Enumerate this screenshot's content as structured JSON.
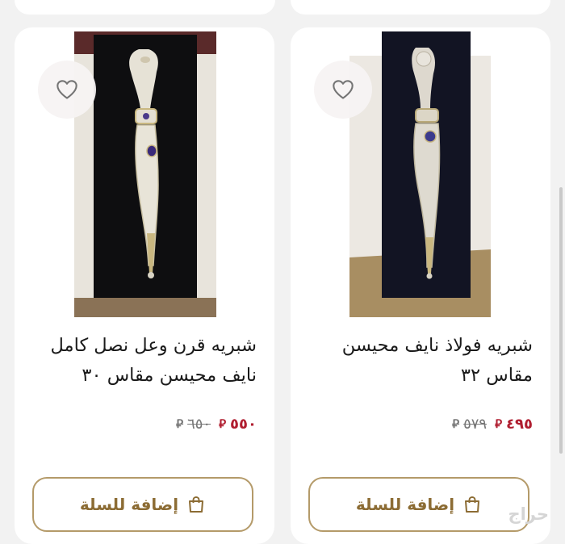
{
  "products": [
    {
      "title": "شبريه قرن وعل نصل كامل نايف محيسن مقاس ٣٠",
      "price_new": "٥٥٠",
      "price_old": "٦٥٠",
      "currency_symbol": "⃁",
      "add_to_cart_label": "إضافة للسلة",
      "favorite_icon": "heart-icon",
      "cart_icon": "shopping-bag-icon"
    },
    {
      "title": "شبريه فولاذ نايف محيسن مقاس ٣٢",
      "price_new": "٤٩٥",
      "price_old": "٥٧٩",
      "currency_symbol": "⃁",
      "add_to_cart_label": "إضافة للسلة",
      "favorite_icon": "heart-icon",
      "cart_icon": "shopping-bag-icon"
    }
  ],
  "watermark": "حراج",
  "colors": {
    "price_red": "#b01e30",
    "button_gold": "#b49a69",
    "background": "#f2f2f2"
  }
}
